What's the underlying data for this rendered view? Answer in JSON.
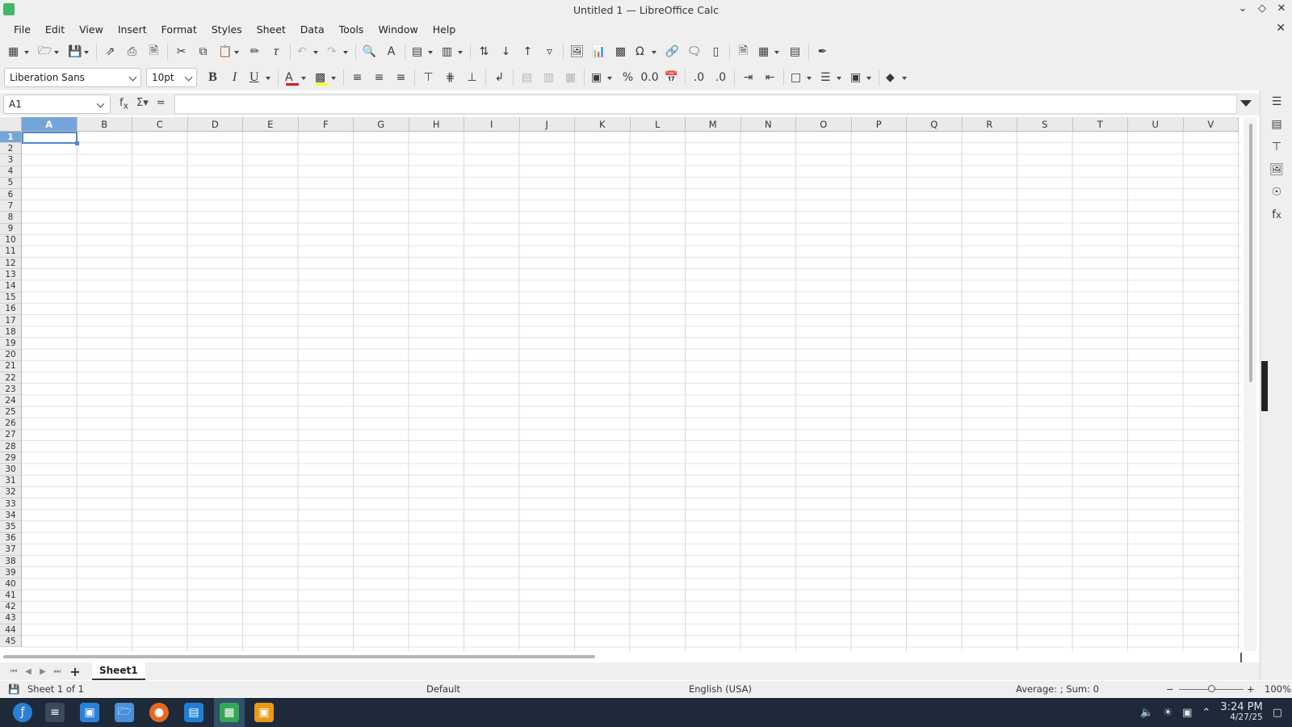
{
  "window": {
    "title": "Untitled 1 — LibreOffice Calc"
  },
  "menu": [
    "File",
    "Edit",
    "View",
    "Insert",
    "Format",
    "Styles",
    "Sheet",
    "Data",
    "Tools",
    "Window",
    "Help"
  ],
  "format_bar": {
    "font_name": "Liberation Sans",
    "font_size": "10pt",
    "font_color": "#c9211e",
    "highlight_color": "#ffff00"
  },
  "formula_bar": {
    "cell_reference": "A1",
    "formula": ""
  },
  "columns": [
    "A",
    "B",
    "C",
    "D",
    "E",
    "F",
    "G",
    "H",
    "I",
    "J",
    "K",
    "L",
    "M",
    "N",
    "O",
    "P",
    "Q",
    "R",
    "S",
    "T",
    "U",
    "V"
  ],
  "rows": [
    "1",
    "2",
    "3",
    "4",
    "5",
    "6",
    "7",
    "8",
    "9",
    "10",
    "11",
    "12",
    "13",
    "14",
    "15",
    "16",
    "17",
    "18",
    "19",
    "20",
    "21",
    "22",
    "23",
    "24",
    "25",
    "26",
    "27",
    "28",
    "29",
    "30",
    "31",
    "32",
    "33",
    "34",
    "35",
    "36",
    "37",
    "38",
    "39",
    "40",
    "41",
    "42",
    "43",
    "44",
    "45"
  ],
  "active_cell": {
    "column": "A",
    "row": "1"
  },
  "sheets": {
    "tabs": [
      "Sheet1"
    ],
    "active": "Sheet1"
  },
  "status": {
    "sheet_info": "Sheet 1 of 1",
    "page_style": "Default",
    "language": "English (USA)",
    "selection_stats": "Average: ; Sum: 0",
    "zoom": "100%"
  },
  "taskbar": {
    "time": "3:24 PM",
    "date": "4/27/25"
  },
  "accent_color": "#4b88d4"
}
